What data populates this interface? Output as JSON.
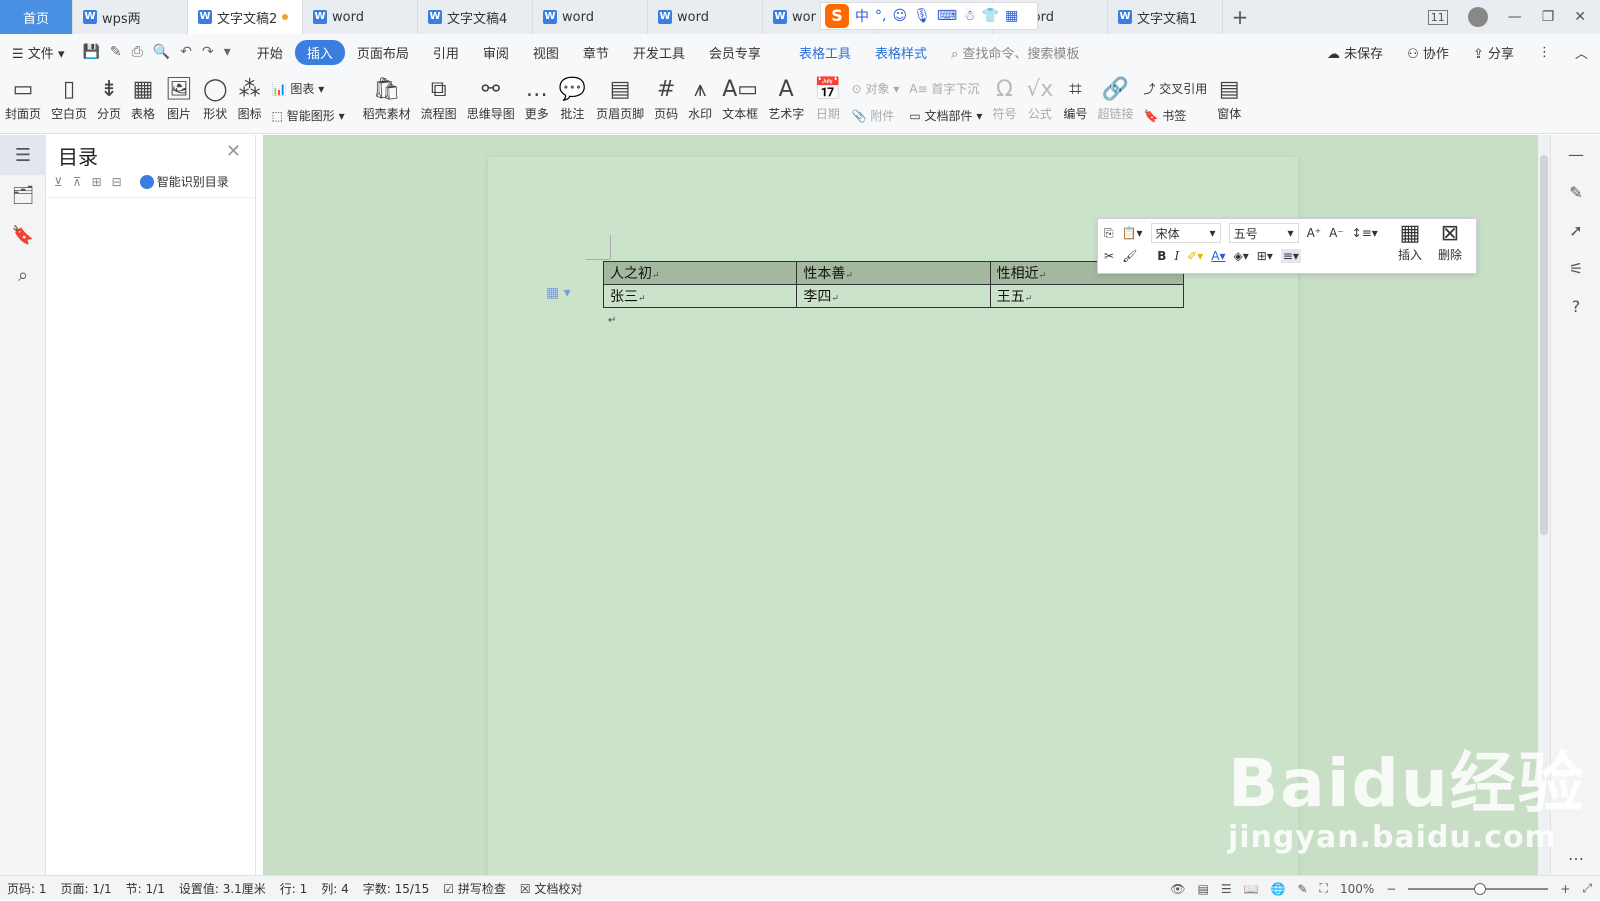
{
  "tabbar": {
    "home": "首页",
    "tabs": [
      {
        "label": "wps两",
        "active": false
      },
      {
        "label": "文字文稿2",
        "active": true
      },
      {
        "label": "word",
        "active": false
      },
      {
        "label": "文字文稿4",
        "active": false
      },
      {
        "label": "word",
        "active": false
      },
      {
        "label": "word",
        "active": false
      },
      {
        "label": "wor",
        "active": false
      },
      {
        "label": "ord",
        "active": false
      },
      {
        "label": "word",
        "active": false
      },
      {
        "label": "文字文稿1",
        "active": false
      }
    ],
    "add_label": "+"
  },
  "ime": {
    "logo": "S",
    "mode": "中",
    "punct": "°,"
  },
  "window": {
    "minimize": "—",
    "restore": "❐",
    "close": "✕",
    "window_count": "11"
  },
  "menubar": {
    "file": "文件",
    "items": [
      "开始",
      "插入",
      "页面布局",
      "引用",
      "审阅",
      "视图",
      "章节",
      "开发工具",
      "会员专享"
    ],
    "active_item": "插入",
    "context_items": [
      "表格工具",
      "表格样式"
    ],
    "search_placeholder": "查找命令、搜索模板",
    "unsaved": "未保存",
    "collab": "协作",
    "share": "分享"
  },
  "ribbon": {
    "group1": [
      "封面页",
      "空白页",
      "分页",
      "表格",
      "图片",
      "形状",
      "图标"
    ],
    "chart": "图表",
    "smart_shape": "智能图形",
    "group2": [
      "稻壳素材",
      "流程图",
      "思维导图",
      "更多",
      "批注",
      "页眉页脚",
      "页码",
      "水印",
      "文本框",
      "艺术字"
    ],
    "date": "日期",
    "object": "对象",
    "attachment": "附件",
    "dropcap": "首字下沉",
    "docpart": "文档部件",
    "symbol": "符号",
    "formula": "公式",
    "numbering": "编号",
    "hyperlink": "超链接",
    "crossref": "交叉引用",
    "bookmark": "书签",
    "form": "窗体"
  },
  "toc": {
    "title": "目录",
    "smart": "智能识别目录"
  },
  "document": {
    "table": [
      [
        "人之初",
        "性本善",
        "性相近"
      ],
      [
        "张三",
        "李四",
        "王五"
      ]
    ],
    "para_mark": "↵"
  },
  "float_toolbar": {
    "font": "宋体",
    "size": "五号",
    "insert": "插入",
    "delete": "删除",
    "bold": "B",
    "italic": "I"
  },
  "status": {
    "page_code": "页码: 1",
    "pages": "页面: 1/1",
    "section": "节: 1/1",
    "setting": "设置值: 3.1厘米",
    "row": "行: 1",
    "col": "列: 4",
    "words": "字数: 15/15",
    "spell": "拼写检查",
    "proof": "文档校对",
    "zoom": "100%"
  },
  "watermark": {
    "main": "Baidu经验",
    "sub": "jingyan.baidu.com"
  }
}
